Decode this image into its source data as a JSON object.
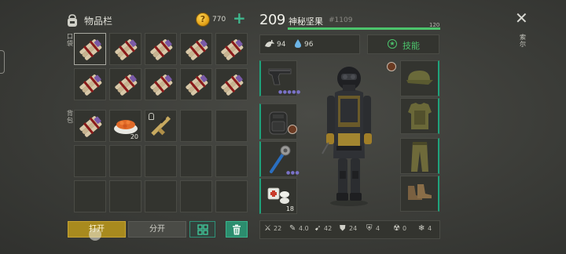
{
  "inventory": {
    "title": "物品栏",
    "coins": "770",
    "pocket_label": "口袋",
    "backpack_label": "背包",
    "rows": [
      [
        {
          "item": "dynamite-bundle",
          "selected": true
        },
        {
          "item": "dynamite-bundle"
        },
        {
          "item": "dynamite-bundle"
        },
        {
          "item": "dynamite-bundle"
        },
        {
          "item": "dynamite-bundle"
        }
      ],
      [
        {
          "item": "dynamite-bundle"
        },
        {
          "item": "dynamite-bundle"
        },
        {
          "item": "dynamite-bundle"
        },
        {
          "item": "dynamite-bundle"
        },
        {
          "item": "dynamite-bundle"
        }
      ],
      [
        {
          "item": "dynamite-bundle"
        },
        {
          "item": "food-bowl",
          "qty": "20"
        },
        {
          "item": "golden-rifle",
          "upgrade": true
        },
        {
          "item": ""
        },
        {
          "item": ""
        }
      ],
      [
        {
          "item": ""
        },
        {
          "item": ""
        },
        {
          "item": ""
        },
        {
          "item": ""
        },
        {
          "item": ""
        }
      ],
      [
        {
          "item": ""
        },
        {
          "item": ""
        },
        {
          "item": ""
        },
        {
          "item": ""
        },
        {
          "item": ""
        }
      ]
    ],
    "open_label": "打开",
    "split_label": "分开"
  },
  "character": {
    "level": "209",
    "name": "神秘坚果",
    "id": "#1109",
    "xp_max": "120",
    "xp_fill": 1.0,
    "food": "94",
    "water": "96",
    "skills_label": "技能",
    "left_slots": [
      {
        "item": "pistol",
        "dots": "●●●●●"
      },
      {
        "item": "backpack-tactical"
      },
      {
        "item": "spiked-mace",
        "dots": "●●●"
      },
      {
        "item": "bandage-pills",
        "qty": "18"
      }
    ],
    "right_slots": [
      {
        "item": "military-cap"
      },
      {
        "item": "body-armor"
      },
      {
        "item": "camo-pants"
      },
      {
        "item": "combat-boots"
      }
    ],
    "stats": [
      {
        "icon": "melee-icon",
        "value": "22"
      },
      {
        "icon": "speed-icon",
        "value": "4.0"
      },
      {
        "icon": "run-icon",
        "value": "42"
      },
      {
        "icon": "armor-icon",
        "value": "24"
      },
      {
        "icon": "bio-shield-icon",
        "value": "4"
      },
      {
        "icon": "radiation-shield-icon",
        "value": "0"
      },
      {
        "icon": "cold-shield-icon",
        "value": "4"
      }
    ]
  },
  "side": {
    "label": "索尔"
  },
  "colors": {
    "accent_green": "#4cc46c",
    "gold": "#c8a534",
    "teal": "#1fa37c"
  }
}
